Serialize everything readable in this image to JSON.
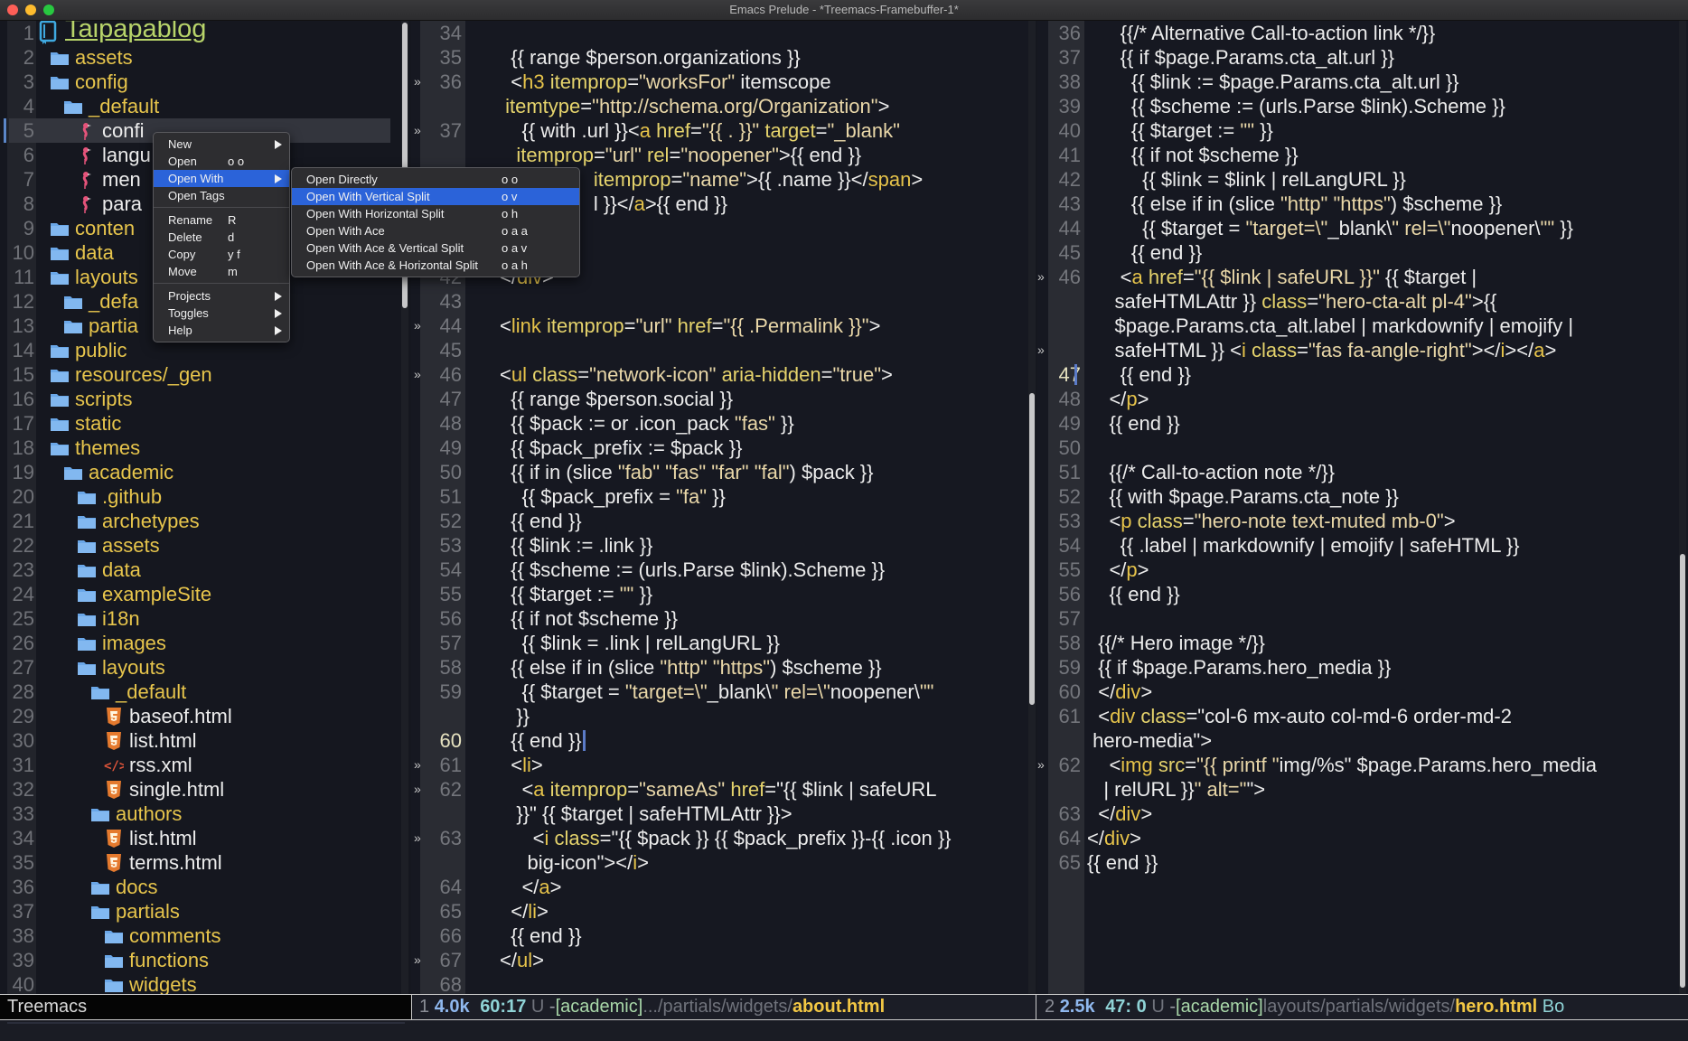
{
  "window": {
    "title": "Emacs Prelude - *Treemacs-Framebuffer-1*"
  },
  "colors": {
    "close": "#fe5f57",
    "minimize": "#febc2e",
    "zoom": "#28c840",
    "accent_blue": "#2b63d9",
    "folder": "#6aa7e8",
    "dir_text": "#e7c54c",
    "root_text": "#b8d46a"
  },
  "tree": {
    "current_row": 5,
    "rows": [
      {
        "n": "1",
        "label": "Taipapablog",
        "icon": "book-icon",
        "level": 0,
        "kind": "root"
      },
      {
        "n": "2",
        "label": "assets",
        "icon": "folder-icon",
        "level": 1,
        "kind": "dir"
      },
      {
        "n": "3",
        "label": "config",
        "icon": "folder-icon",
        "level": 1,
        "kind": "dir"
      },
      {
        "n": "4",
        "label": "_default",
        "icon": "folder-icon",
        "level": 2,
        "kind": "dir"
      },
      {
        "n": "5",
        "label": "confi",
        "icon": "yaml-flamingo-icon",
        "level": 3,
        "kind": "file"
      },
      {
        "n": "6",
        "label": "langu",
        "icon": "yaml-flamingo-icon",
        "level": 3,
        "kind": "file"
      },
      {
        "n": "7",
        "label": "men",
        "icon": "yaml-flamingo-icon",
        "level": 3,
        "kind": "file"
      },
      {
        "n": "8",
        "label": "para",
        "icon": "yaml-flamingo-icon",
        "level": 3,
        "kind": "file"
      },
      {
        "n": "9",
        "label": "conten",
        "icon": "folder-icon",
        "level": 1,
        "kind": "dir"
      },
      {
        "n": "10",
        "label": "data",
        "icon": "folder-icon",
        "level": 1,
        "kind": "dir"
      },
      {
        "n": "11",
        "label": "layouts",
        "icon": "folder-icon",
        "level": 1,
        "kind": "dir"
      },
      {
        "n": "12",
        "label": "_defa",
        "icon": "folder-icon",
        "level": 2,
        "kind": "dir"
      },
      {
        "n": "13",
        "label": "partia",
        "icon": "folder-icon",
        "level": 2,
        "kind": "dir"
      },
      {
        "n": "14",
        "label": "public",
        "icon": "folder-icon",
        "level": 1,
        "kind": "dir"
      },
      {
        "n": "15",
        "label": "resources/_gen",
        "icon": "folder-icon",
        "level": 1,
        "kind": "dir"
      },
      {
        "n": "16",
        "label": "scripts",
        "icon": "folder-icon",
        "level": 1,
        "kind": "dir"
      },
      {
        "n": "17",
        "label": "static",
        "icon": "folder-icon",
        "level": 1,
        "kind": "dir"
      },
      {
        "n": "18",
        "label": "themes",
        "icon": "folder-icon",
        "level": 1,
        "kind": "dir"
      },
      {
        "n": "19",
        "label": "academic",
        "icon": "folder-icon",
        "level": 2,
        "kind": "dir"
      },
      {
        "n": "20",
        "label": ".github",
        "icon": "folder-icon",
        "level": 3,
        "kind": "dir"
      },
      {
        "n": "21",
        "label": "archetypes",
        "icon": "folder-icon",
        "level": 3,
        "kind": "dir"
      },
      {
        "n": "22",
        "label": "assets",
        "icon": "folder-icon",
        "level": 3,
        "kind": "dir"
      },
      {
        "n": "23",
        "label": "data",
        "icon": "folder-icon",
        "level": 3,
        "kind": "dir"
      },
      {
        "n": "24",
        "label": "exampleSite",
        "icon": "folder-icon",
        "level": 3,
        "kind": "dir"
      },
      {
        "n": "25",
        "label": "i18n",
        "icon": "folder-icon",
        "level": 3,
        "kind": "dir"
      },
      {
        "n": "26",
        "label": "images",
        "icon": "folder-icon",
        "level": 3,
        "kind": "dir"
      },
      {
        "n": "27",
        "label": "layouts",
        "icon": "folder-icon",
        "level": 3,
        "kind": "dir"
      },
      {
        "n": "28",
        "label": "_default",
        "icon": "folder-icon",
        "level": 4,
        "kind": "dir"
      },
      {
        "n": "29",
        "label": "baseof.html",
        "icon": "html5-icon",
        "level": 5,
        "kind": "file"
      },
      {
        "n": "30",
        "label": "list.html",
        "icon": "html5-icon",
        "level": 5,
        "kind": "file"
      },
      {
        "n": "31",
        "label": "rss.xml",
        "icon": "xml-code-icon",
        "level": 5,
        "kind": "file"
      },
      {
        "n": "32",
        "label": "single.html",
        "icon": "html5-icon",
        "level": 5,
        "kind": "file"
      },
      {
        "n": "33",
        "label": "authors",
        "icon": "folder-icon",
        "level": 4,
        "kind": "dir"
      },
      {
        "n": "34",
        "label": "list.html",
        "icon": "html5-icon",
        "level": 5,
        "kind": "file"
      },
      {
        "n": "35",
        "label": "terms.html",
        "icon": "html5-icon",
        "level": 5,
        "kind": "file"
      },
      {
        "n": "36",
        "label": "docs",
        "icon": "folder-icon",
        "level": 4,
        "kind": "dir"
      },
      {
        "n": "37",
        "label": "partials",
        "icon": "folder-icon",
        "level": 4,
        "kind": "dir"
      },
      {
        "n": "38",
        "label": "comments",
        "icon": "folder-icon",
        "level": 5,
        "kind": "dir"
      },
      {
        "n": "39",
        "label": "functions",
        "icon": "folder-icon",
        "level": 5,
        "kind": "dir"
      },
      {
        "n": "40",
        "label": "widgets",
        "icon": "folder-icon",
        "level": 5,
        "kind": "dir"
      }
    ]
  },
  "context_menu": {
    "groups": [
      [
        {
          "label": "New",
          "shortcut": "",
          "submenu": true
        },
        {
          "label": "Open",
          "shortcut": "o o",
          "submenu": false
        },
        {
          "label": "Open With",
          "shortcut": "",
          "submenu": true,
          "highlighted": true
        },
        {
          "label": "Open Tags",
          "shortcut": "",
          "submenu": false
        }
      ],
      [
        {
          "label": "Rename",
          "shortcut": "R",
          "submenu": false
        },
        {
          "label": "Delete",
          "shortcut": "d",
          "submenu": false
        },
        {
          "label": "Copy",
          "shortcut": "y f",
          "submenu": false
        },
        {
          "label": "Move",
          "shortcut": "m",
          "submenu": false
        }
      ],
      [
        {
          "label": "Projects",
          "shortcut": "",
          "submenu": true
        },
        {
          "label": "Toggles",
          "shortcut": "",
          "submenu": true
        },
        {
          "label": "Help",
          "shortcut": "",
          "submenu": true
        }
      ]
    ]
  },
  "submenu": {
    "items": [
      {
        "label": "Open Directly",
        "shortcut": "o o"
      },
      {
        "label": "Open With Vertical Split",
        "shortcut": "o v",
        "highlighted": true
      },
      {
        "label": "Open With Horizontal Split",
        "shortcut": "o h"
      },
      {
        "label": "Open With Ace",
        "shortcut": "o a a"
      },
      {
        "label": "Open With Ace & Vertical Split",
        "shortcut": "o a v"
      },
      {
        "label": "Open With Ace & Horizontal Split",
        "shortcut": "o a h"
      }
    ]
  },
  "editors": [
    {
      "current_line": "60",
      "rows": [
        [
          "34",
          "",
          0
        ],
        [
          "35",
          "  {{ range $person.organizations }}",
          0
        ],
        [
          "36",
          "  <h3 itemprop=\"worksFor\" itemscope",
          1
        ],
        [
          "",
          " itemtype=\"http://schema.org/Organization\">",
          0
        ],
        [
          "37",
          "    {{ with .url }}<a href=\"{{ . }}\" target=\"_blank\"",
          1
        ],
        [
          "",
          "   itemprop=\"url\" rel=\"noopener\">{{ end }}",
          0
        ],
        [
          "38",
          "                 itemprop=\"name\">{{ .name }}</span>",
          0
        ],
        [
          "39",
          "                 l }}</a>{{ end }}",
          0
        ],
        [
          "40",
          "",
          0
        ],
        [
          "41",
          "",
          0
        ],
        [
          "42",
          "</div>",
          0
        ],
        [
          "43",
          "",
          0
        ],
        [
          "44",
          "<link itemprop=\"url\" href=\"{{ .Permalink }}\">",
          1
        ],
        [
          "45",
          "",
          0
        ],
        [
          "46",
          "<ul class=\"network-icon\" aria-hidden=\"true\">",
          1
        ],
        [
          "47",
          "  {{ range $person.social }}",
          0
        ],
        [
          "48",
          "  {{ $pack := or .icon_pack \"fas\" }}",
          0
        ],
        [
          "49",
          "  {{ $pack_prefix := $pack }}",
          0
        ],
        [
          "50",
          "  {{ if in (slice \"fab\" \"fas\" \"far\" \"fal\") $pack }}",
          0
        ],
        [
          "51",
          "    {{ $pack_prefix = \"fa\" }}",
          0
        ],
        [
          "52",
          "  {{ end }}",
          0
        ],
        [
          "53",
          "  {{ $link := .link }}",
          0
        ],
        [
          "54",
          "  {{ $scheme := (urls.Parse $link).Scheme }}",
          0
        ],
        [
          "55",
          "  {{ $target := \"\" }}",
          0
        ],
        [
          "56",
          "  {{ if not $scheme }}",
          0
        ],
        [
          "57",
          "    {{ $link = .link | relLangURL }}",
          0
        ],
        [
          "58",
          "  {{ else if in (slice \"http\" \"https\") $scheme }}",
          0
        ],
        [
          "59",
          "    {{ $target = \"target=\\\"_blank\\\" rel=\\\"noopener\\\"\"",
          0
        ],
        [
          "",
          "   }}",
          0
        ],
        [
          "60",
          "  {{ end }}",
          0
        ],
        [
          "61",
          "  <li>",
          1
        ],
        [
          "62",
          "    <a itemprop=\"sameAs\" href=\"{{ $link | safeURL",
          1
        ],
        [
          "",
          "   }}\" {{ $target | safeHTMLAttr }}>",
          0
        ],
        [
          "63",
          "      <i class=\"{{ $pack }} {{ $pack_prefix }}-{{ .icon }}",
          1
        ],
        [
          "",
          "     big-icon\"></i>",
          0
        ],
        [
          "64",
          "    </a>",
          0
        ],
        [
          "65",
          "  </li>",
          0
        ],
        [
          "66",
          "  {{ end }}",
          0
        ],
        [
          "67",
          "</ul>",
          1
        ],
        [
          "68",
          "",
          0
        ]
      ]
    },
    {
      "current_line": "47",
      "rows": [
        [
          "36",
          "      {{/* Alternative Call-to-action link */}}",
          0
        ],
        [
          "37",
          "      {{ if $page.Params.cta_alt.url }}",
          0
        ],
        [
          "38",
          "        {{ $link := $page.Params.cta_alt.url }}",
          0
        ],
        [
          "39",
          "        {{ $scheme := (urls.Parse $link).Scheme }}",
          0
        ],
        [
          "40",
          "        {{ $target := \"\" }}",
          0
        ],
        [
          "41",
          "        {{ if not $scheme }}",
          0
        ],
        [
          "42",
          "          {{ $link = $link | relLangURL }}",
          0
        ],
        [
          "43",
          "        {{ else if in (slice \"http\" \"https\") $scheme }}",
          0
        ],
        [
          "44",
          "          {{ $target = \"target=\\\"_blank\\\" rel=\\\"noopener\\\"\" }}",
          0
        ],
        [
          "45",
          "        {{ end }}",
          0
        ],
        [
          "46",
          "      <a href=\"{{ $link | safeURL }}\" {{ $target |",
          1
        ],
        [
          "",
          "     safeHTMLAttr }} class=\"hero-cta-alt pl-4\">{{",
          0
        ],
        [
          "",
          "     $page.Params.cta_alt.label | markdownify | emojify |",
          0
        ],
        [
          "",
          "     safeHTML }} <i class=\"fas fa-angle-right\"></i></a>",
          1
        ],
        [
          "47",
          "      {{ end }}",
          0
        ],
        [
          "48",
          "    </p>",
          0
        ],
        [
          "49",
          "    {{ end }}",
          0
        ],
        [
          "50",
          "",
          0
        ],
        [
          "51",
          "    {{/* Call-to-action note */}}",
          0
        ],
        [
          "52",
          "    {{ with $page.Params.cta_note }}",
          0
        ],
        [
          "53",
          "    <p class=\"hero-note text-muted mb-0\">",
          0
        ],
        [
          "54",
          "      {{ .label | markdownify | emojify | safeHTML }}",
          0
        ],
        [
          "55",
          "    </p>",
          0
        ],
        [
          "56",
          "    {{ end }}",
          0
        ],
        [
          "57",
          "",
          0
        ],
        [
          "58",
          "  {{/* Hero image */}}",
          0
        ],
        [
          "59",
          "  {{ if $page.Params.hero_media }}",
          0
        ],
        [
          "60",
          "  </div>",
          0
        ],
        [
          "61",
          "  <div class=\"col-6 mx-auto col-md-6 order-md-2",
          0
        ],
        [
          "",
          " hero-media\">",
          0
        ],
        [
          "62",
          "    <img src=\"{{ printf \"img/%s\" $page.Params.hero_media",
          1
        ],
        [
          "",
          "   | relURL }}\" alt=\"\">",
          0
        ],
        [
          "63",
          "  </div>",
          0
        ],
        [
          "64",
          "</div>",
          0
        ],
        [
          "65",
          "{{ end }}",
          0
        ]
      ]
    }
  ],
  "modeline": {
    "treemacs": "Treemacs",
    "left": {
      "window": "1",
      "size": "4.0k",
      "position": "60:17",
      "encoding": "U",
      "dash": "-",
      "project": "[academic]",
      "path": ".../partials/widgets/",
      "file": "about.html"
    },
    "right": {
      "window": "2",
      "size": "2.5k",
      "position": "47: 0",
      "encoding": "U",
      "dash": "-",
      "project": "[academic]",
      "path": "layouts/partials/widgets/",
      "file": "hero.html",
      "mode": "Bo"
    }
  }
}
